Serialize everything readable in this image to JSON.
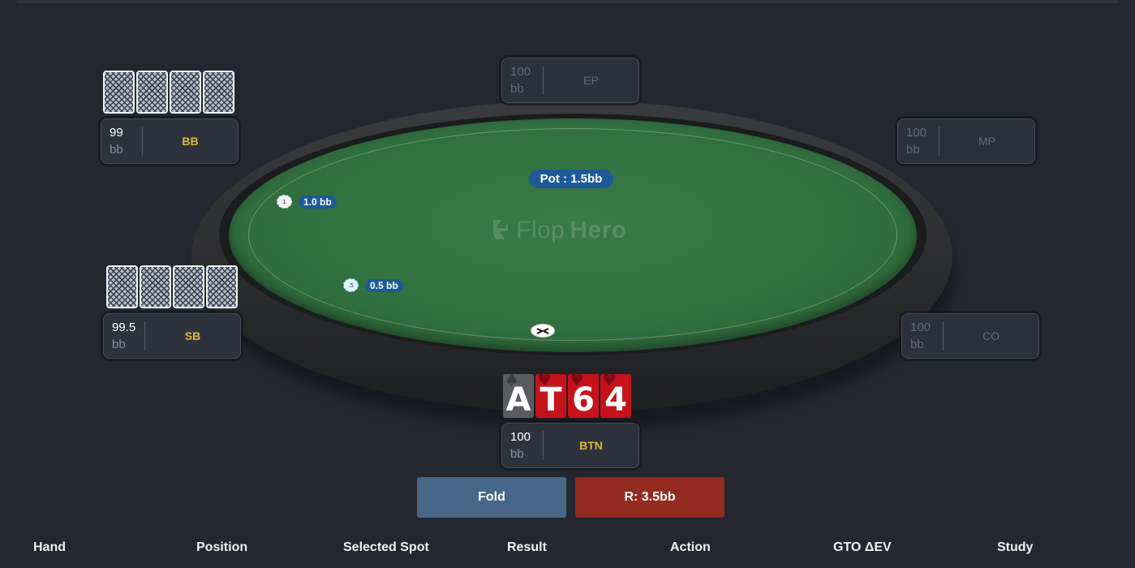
{
  "table": {
    "pot_label": "Pot : 1.5bb",
    "logo": {
      "part1": "Flop",
      "part2": "Hero"
    }
  },
  "bets": [
    {
      "seat": "BB",
      "amount": "1.0 bb",
      "chip_icon": "chip-icon"
    },
    {
      "seat": "SB",
      "amount": "0.5 bb",
      "chip_icon": "chip-icon"
    }
  ],
  "dealer_button": {
    "icon": "dealer-button-icon"
  },
  "seats": {
    "ep": {
      "stack": "100",
      "unit": "bb",
      "position": "EP",
      "active": false
    },
    "mp": {
      "stack": "100",
      "unit": "bb",
      "position": "MP",
      "active": false
    },
    "co": {
      "stack": "100",
      "unit": "bb",
      "position": "CO",
      "active": false
    },
    "bb": {
      "stack": "99",
      "unit": "bb",
      "position": "BB",
      "active": true
    },
    "sb": {
      "stack": "99.5",
      "unit": "bb",
      "position": "SB",
      "active": true
    },
    "btn": {
      "stack": "100",
      "unit": "bb",
      "position": "BTN",
      "active": true
    }
  },
  "hero_hand": [
    {
      "rank": "A",
      "suit": "♠",
      "suit_name": "spade"
    },
    {
      "rank": "T",
      "suit": "♥",
      "suit_name": "heart"
    },
    {
      "rank": "6",
      "suit": "♥",
      "suit_name": "heart"
    },
    {
      "rank": "4",
      "suit": "♥",
      "suit_name": "heart"
    }
  ],
  "actions": {
    "fold_label": "Fold",
    "raise_label": "R: 3.5bb"
  },
  "results_columns": [
    "Hand",
    "Position",
    "Selected Spot",
    "Result",
    "Action",
    "GTO ΔEV",
    "Study"
  ],
  "colors": {
    "background": "#242730",
    "felt": "#327040",
    "accent_blue": "#1d5a97",
    "fold": "#476789",
    "raise": "#922a1f",
    "position_gold": "#e0b93a",
    "heart_card": "#c6121b",
    "spade_card": "#5a5c60"
  }
}
